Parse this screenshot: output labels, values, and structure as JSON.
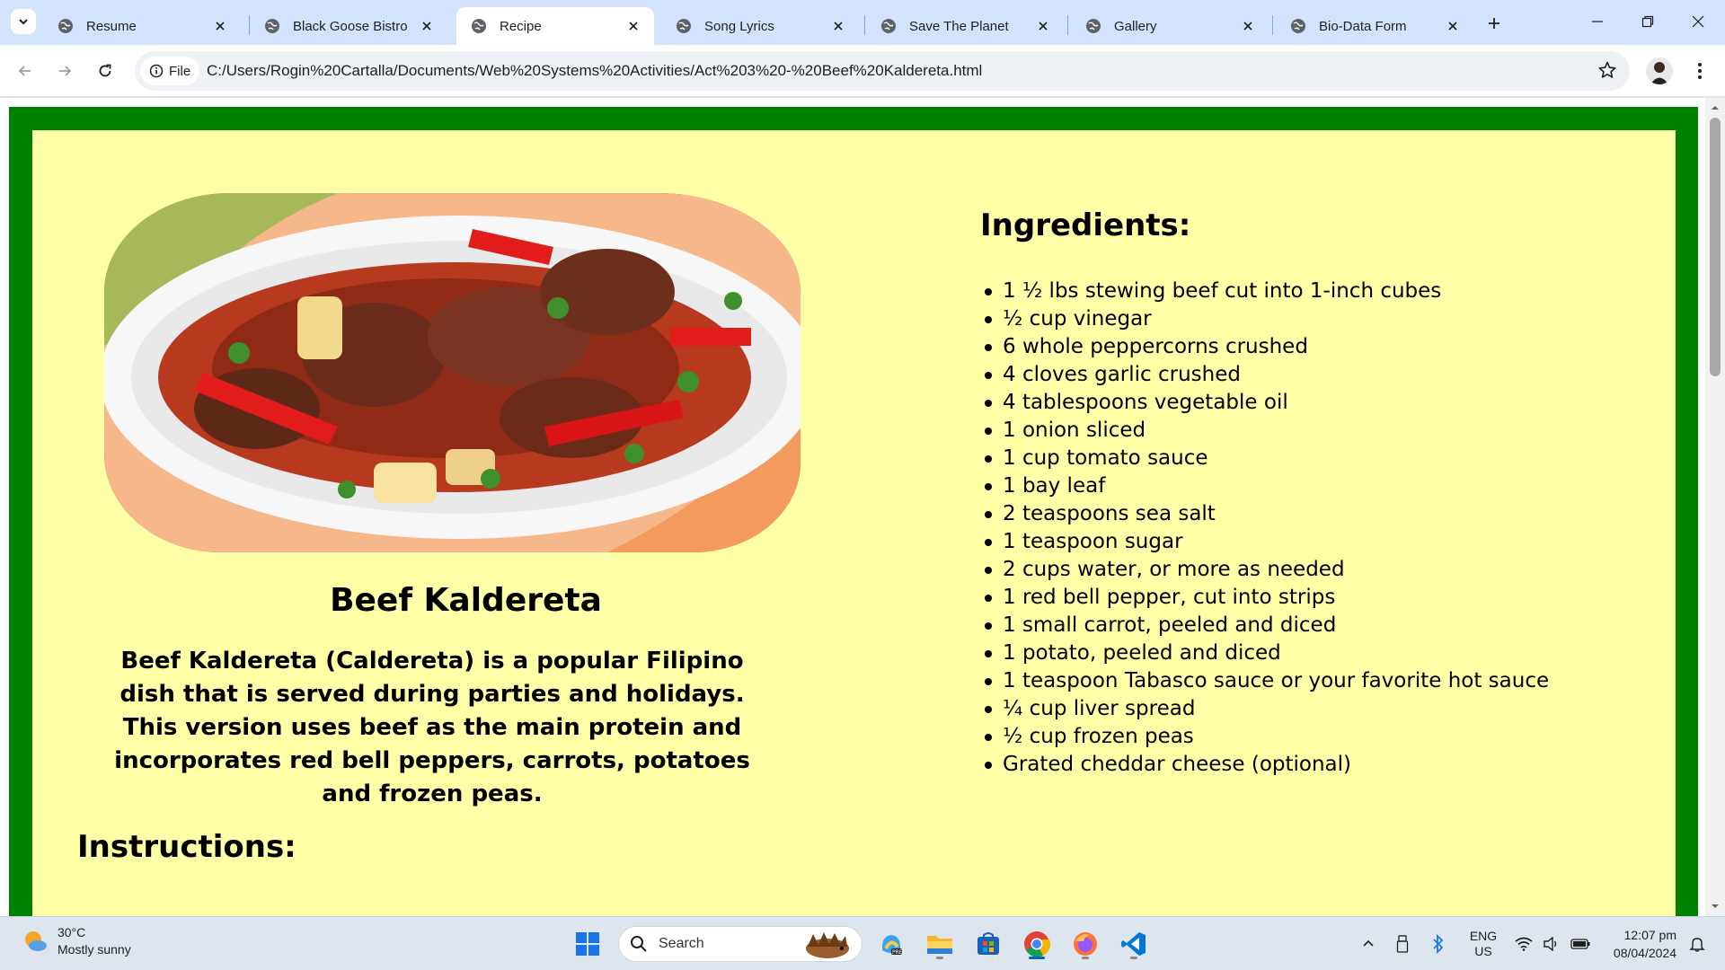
{
  "browser": {
    "tabs": [
      {
        "title": "Resume",
        "active": false
      },
      {
        "title": "Black Goose Bistro",
        "active": false
      },
      {
        "title": "Recipe",
        "active": true
      },
      {
        "title": "Song Lyrics",
        "active": false
      },
      {
        "title": "Save The Planet",
        "active": false
      },
      {
        "title": "Gallery",
        "active": false
      },
      {
        "title": "Bio-Data Form",
        "active": false
      }
    ],
    "scheme_chip": "File",
    "url": "C:/Users/Rogin%20Cartalla/Documents/Web%20Systems%20Activities/Act%203%20-%20Beef%20Kaldereta.html",
    "icons": [
      "tab-search-icon",
      "globe-icon",
      "close-icon",
      "plus-icon",
      "minimize-icon",
      "restore-icon",
      "close-window-icon",
      "back-arrow-icon",
      "forward-arrow-icon",
      "reload-icon",
      "info-icon",
      "star-icon",
      "profile-avatar",
      "more-vert-icon"
    ]
  },
  "page": {
    "recipe_title": "Beef Kaldereta",
    "description": "Beef Kaldereta (Caldereta) is a popular Filipino dish that is served during parties and holidays. This version uses beef as the main protein and incorporates red bell peppers, carrots, potatoes and frozen peas.",
    "ingredients_heading": "Ingredients:",
    "ingredients": [
      "1 ½ lbs stewing beef cut into 1-inch cubes",
      "½ cup vinegar",
      "6 whole peppercorns crushed",
      "4 cloves garlic crushed",
      "4 tablespoons vegetable oil",
      "1 onion sliced",
      "1 cup tomato sauce",
      "1 bay leaf",
      "2 teaspoons sea salt",
      "1 teaspoon sugar",
      "2 cups water, or more as needed",
      "1 red bell pepper, cut into strips",
      "1 small carrot, peeled and diced",
      "1 potato, peeled and diced",
      "1 teaspoon Tabasco sauce or your favorite hot sauce",
      "¼ cup liver spread",
      "½ cup frozen peas",
      "Grated cheddar cheese (optional)"
    ],
    "instructions_heading": "Instructions:",
    "colors": {
      "frame": "#008000",
      "panel": "#ffffa8"
    }
  },
  "taskbar": {
    "weather_temp": "30°C",
    "weather_desc": "Mostly sunny",
    "search_placeholder": "Search",
    "lang_line1": "ENG",
    "lang_line2": "US",
    "time": "12:07 pm",
    "date": "08/04/2024",
    "apps": [
      "start-icon",
      "copilot-icon",
      "file-explorer-icon",
      "microsoft-store-icon",
      "chrome-icon",
      "firefox-icon",
      "vscode-icon"
    ]
  }
}
